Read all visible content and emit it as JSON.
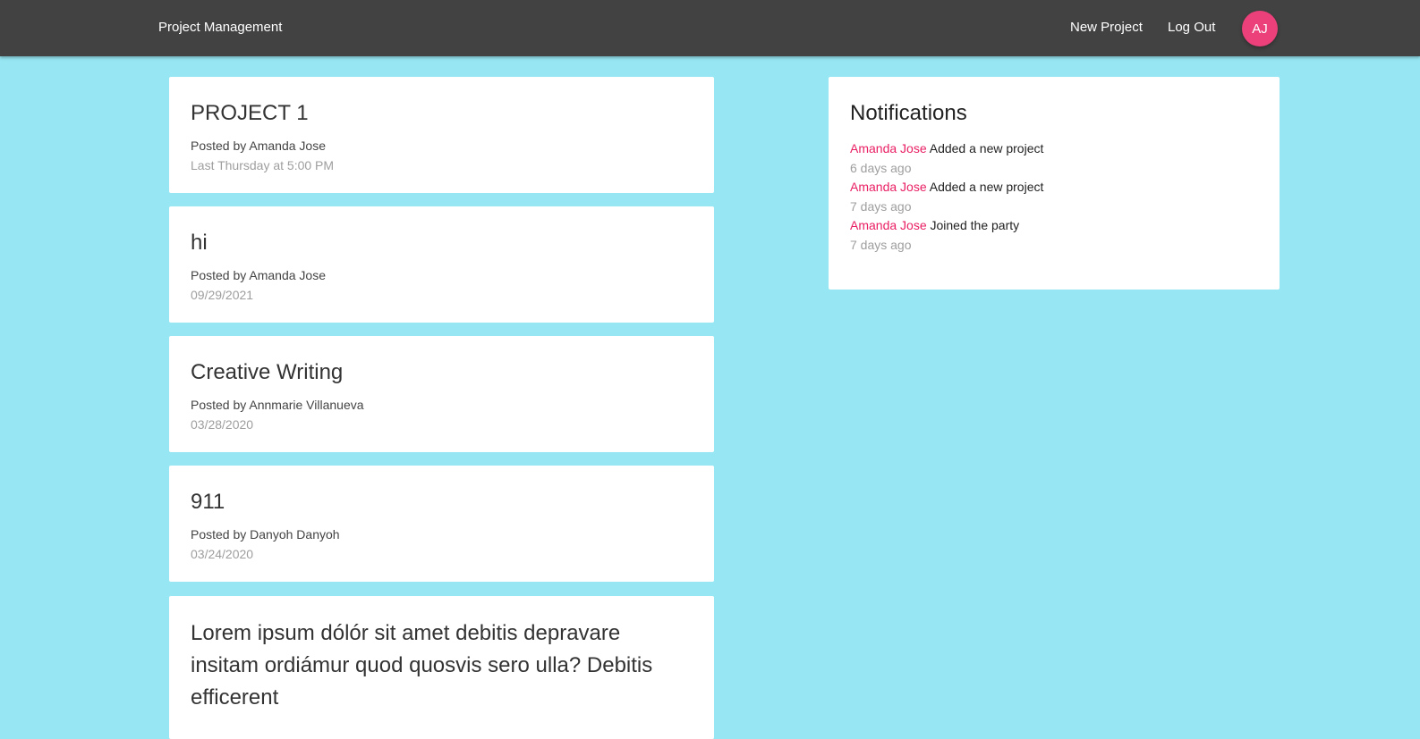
{
  "nav": {
    "brand": "Project Management",
    "new_project": "New Project",
    "log_out": "Log Out",
    "avatar_initials": "AJ"
  },
  "projects": [
    {
      "title": "PROJECT 1",
      "author": "Posted by Amanda Jose",
      "date": "Last Thursday at 5:00 PM"
    },
    {
      "title": "hi",
      "author": "Posted by Amanda Jose",
      "date": "09/29/2021"
    },
    {
      "title": "Creative Writing",
      "author": "Posted by Annmarie Villanueva",
      "date": "03/28/2020"
    },
    {
      "title": "911",
      "author": "Posted by Danyoh Danyoh",
      "date": "03/24/2020"
    },
    {
      "title": "Lorem ipsum dólór sit amet debitis depravare insitam ordiámur quod quosvis sero ulla? Debitis efficerent"
    }
  ],
  "notifications": {
    "title": "Notifications",
    "items": [
      {
        "user": "Amanda Jose",
        "action": "Added a new project",
        "time": "6 days ago"
      },
      {
        "user": "Amanda Jose",
        "action": "Added a new project",
        "time": "7 days ago"
      },
      {
        "user": "Amanda Jose",
        "action": "Joined the party",
        "time": "7 days ago"
      }
    ]
  },
  "colors": {
    "navbar": "#424242",
    "background": "#96e6f3",
    "accent": "#e91e63",
    "avatar": "#ec407a"
  }
}
